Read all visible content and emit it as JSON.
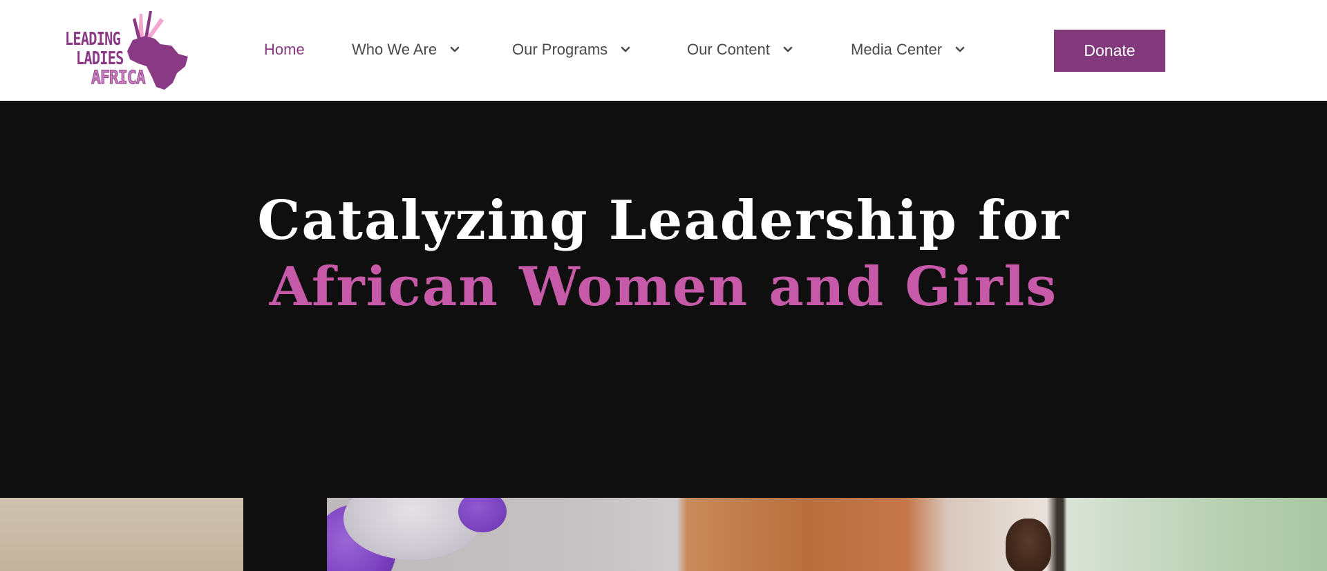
{
  "logo": {
    "alt": "Leading Ladies Africa",
    "line1": "LEADING",
    "line2": "LADIES",
    "line3": "AFRICA",
    "icon": "africa-map-icon"
  },
  "nav": {
    "items": [
      {
        "label": "Home",
        "active": true,
        "has_dropdown": false
      },
      {
        "label": "Who We Are",
        "active": false,
        "has_dropdown": true
      },
      {
        "label": "Our Programs",
        "active": false,
        "has_dropdown": true
      },
      {
        "label": "Our Content",
        "active": false,
        "has_dropdown": true
      },
      {
        "label": "Media Center",
        "active": false,
        "has_dropdown": true
      }
    ],
    "dropdown_icon": "chevron-down-icon"
  },
  "donate": {
    "label": "Donate"
  },
  "hero": {
    "line1": "Catalyzing Leadership for",
    "line2": "African Women and Girls"
  },
  "colors": {
    "brand_purple": "#823a7c",
    "accent_pink": "#c65aa8",
    "hero_bg": "#0f0f10",
    "nav_text": "#4a4a4a"
  }
}
